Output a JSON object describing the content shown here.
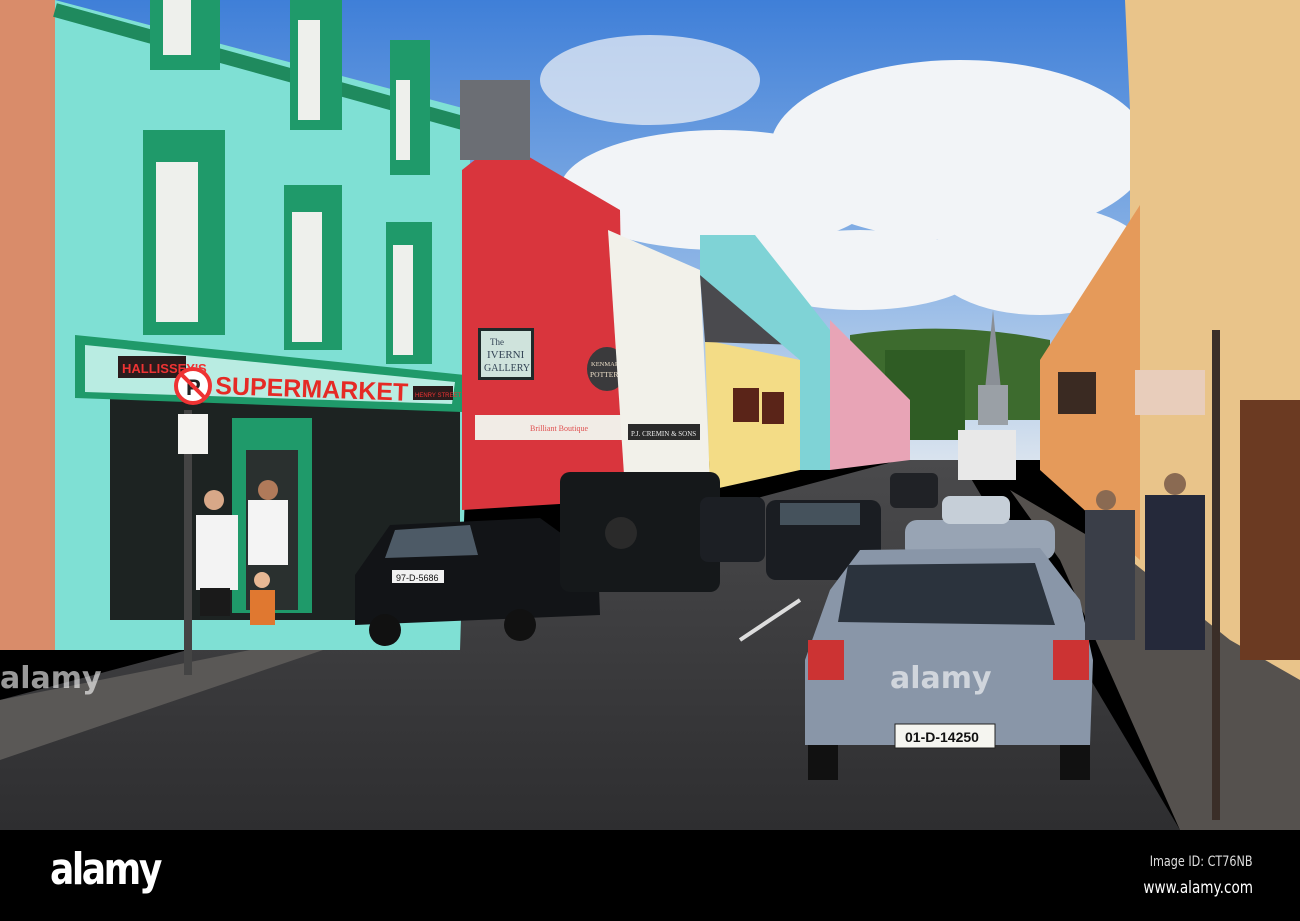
{
  "photo": {
    "signs": {
      "shop_name": "HALLISSEY'S",
      "supermarket": "SUPERMARKET",
      "street_plate": "HENRY STREET",
      "no_parking": "P",
      "gallery_line1": "The",
      "gallery_line2": "IVERNI",
      "gallery_line3": "GALLERY",
      "pottery_line1": "KENMARE",
      "pottery_line2": "POTTERY",
      "cremin": "P.J. CREMIN & SONS",
      "boutique": "Brilliant Boutique"
    },
    "plates": {
      "front_car": "01-D-14250",
      "left_car": "97-D-5686"
    },
    "watermark": "alamy"
  },
  "banner": {
    "logo": "alamy",
    "image_id": "Image ID: CT76NB",
    "website": "www.alamy.com"
  }
}
